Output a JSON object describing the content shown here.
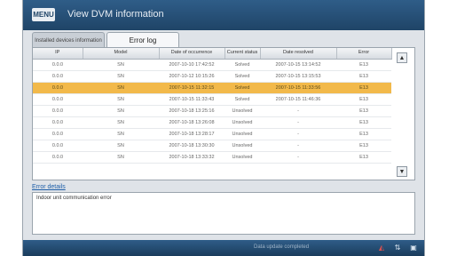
{
  "window": {
    "menu_label": "MENU",
    "title": "View DVM information"
  },
  "tabs": [
    {
      "label": "Installed devices information",
      "active": false
    },
    {
      "label": "Error log",
      "active": true
    }
  ],
  "table": {
    "headers": [
      "IP",
      "Model",
      "Date of occurrence",
      "Current status",
      "Date resolved",
      "Error"
    ],
    "rows": [
      [
        "0.0.0",
        "SN",
        "2007-10-10 17:42:52",
        "Solved",
        "2007-10-15 13:14:52",
        "E13",
        false
      ],
      [
        "0.0.0",
        "SN",
        "2007-10-12 10:15:26",
        "Solved",
        "2007-10-15 13:15:53",
        "E13",
        false
      ],
      [
        "0.0.0",
        "SN",
        "2007-10-15 11:32:15",
        "Solved",
        "2007-10-15 11:33:56",
        "E13",
        true
      ],
      [
        "0.0.0",
        "SN",
        "2007-10-15 11:33:43",
        "Solved",
        "2007-10-15 11:46:36",
        "E13",
        false
      ],
      [
        "0.0.0",
        "SN",
        "2007-10-18 13:25:16",
        "Unsolved",
        "-",
        "E13",
        false
      ],
      [
        "0.0.0",
        "SN",
        "2007-10-18 13:26:08",
        "Unsolved",
        "-",
        "E13",
        false
      ],
      [
        "0.0.0",
        "SN",
        "2007-10-18 13:28:17",
        "Unsolved",
        "-",
        "E13",
        false
      ],
      [
        "0.0.0",
        "SN",
        "2007-10-18 13:30:30",
        "Unsolved",
        "-",
        "E13",
        false
      ],
      [
        "0.0.0",
        "SN",
        "2007-10-18 13:33:32",
        "Unsolved",
        "-",
        "E13",
        false
      ]
    ]
  },
  "details": {
    "label": "Error details",
    "text": "Indoor unit communication error"
  },
  "status_bar": {
    "text": "Data update completed",
    "icons": [
      "signal-icon",
      "network-icon",
      "monitor-icon"
    ]
  },
  "colors": {
    "title_bar": "#2f5d88",
    "selected_row": "#f2b94a",
    "link": "#1f5fa8"
  }
}
